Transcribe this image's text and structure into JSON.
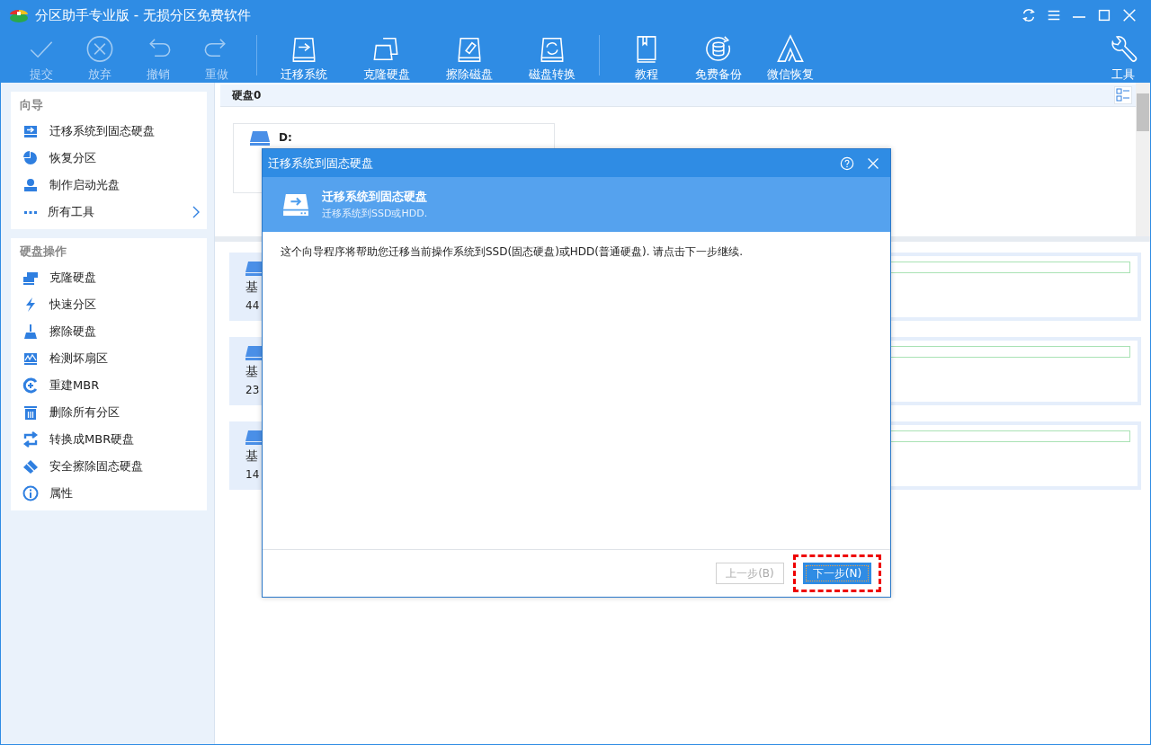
{
  "window": {
    "title": "分区助手专业版 - 无损分区免费软件"
  },
  "toolbar": [
    {
      "label": "提交",
      "disabled": true
    },
    {
      "label": "放弃",
      "disabled": true
    },
    {
      "label": "撤销",
      "disabled": true
    },
    {
      "label": "重做",
      "disabled": true
    },
    {
      "label": "迁移系统",
      "disabled": false,
      "group_start": true
    },
    {
      "label": "克隆硬盘",
      "disabled": false
    },
    {
      "label": "擦除磁盘",
      "disabled": false
    },
    {
      "label": "磁盘转换",
      "disabled": false
    },
    {
      "label": "教程",
      "disabled": false,
      "group_start": true
    },
    {
      "label": "免费备份",
      "disabled": false
    },
    {
      "label": "微信恢复",
      "disabled": false
    }
  ],
  "tools_button": {
    "label": "工具"
  },
  "sidebar": [
    {
      "title": "向导",
      "items": [
        {
          "label": "迁移系统到固态硬盘"
        },
        {
          "label": "恢复分区"
        },
        {
          "label": "制作启动光盘"
        },
        {
          "label": "所有工具",
          "submenu": true
        }
      ]
    },
    {
      "title": "硬盘操作",
      "items": [
        {
          "label": "克隆硬盘"
        },
        {
          "label": "快速分区"
        },
        {
          "label": "擦除硬盘"
        },
        {
          "label": "检测坏扇区"
        },
        {
          "label": "重建MBR"
        },
        {
          "label": "删除所有分区"
        },
        {
          "label": "转换成MBR硬盘"
        },
        {
          "label": "安全擦除固态硬盘"
        },
        {
          "label": "属性"
        }
      ]
    }
  ],
  "disk_view": {
    "title": "硬盘0",
    "partition_label": "D:"
  },
  "disk_rows": [
    {
      "line_1": "基",
      "line_2": "44"
    },
    {
      "line_1": "基",
      "line_2": "23"
    },
    {
      "line_1": "基",
      "line_2": "14"
    }
  ],
  "dialog": {
    "title": "迁移系统到固态硬盘",
    "heading": "迁移系统到固态硬盘",
    "subheading": "迁移系统到SSD或HDD.",
    "message": "这个向导程序将帮助您迁移当前操作系统到SSD(固态硬盘)或HDD(普通硬盘). 请点击下一步继续.",
    "buttons": [
      {
        "label": "上一步(B)",
        "disabled": true,
        "highlighted": false
      },
      {
        "label": "下一步(N)",
        "disabled": false,
        "highlighted": true
      }
    ]
  }
}
